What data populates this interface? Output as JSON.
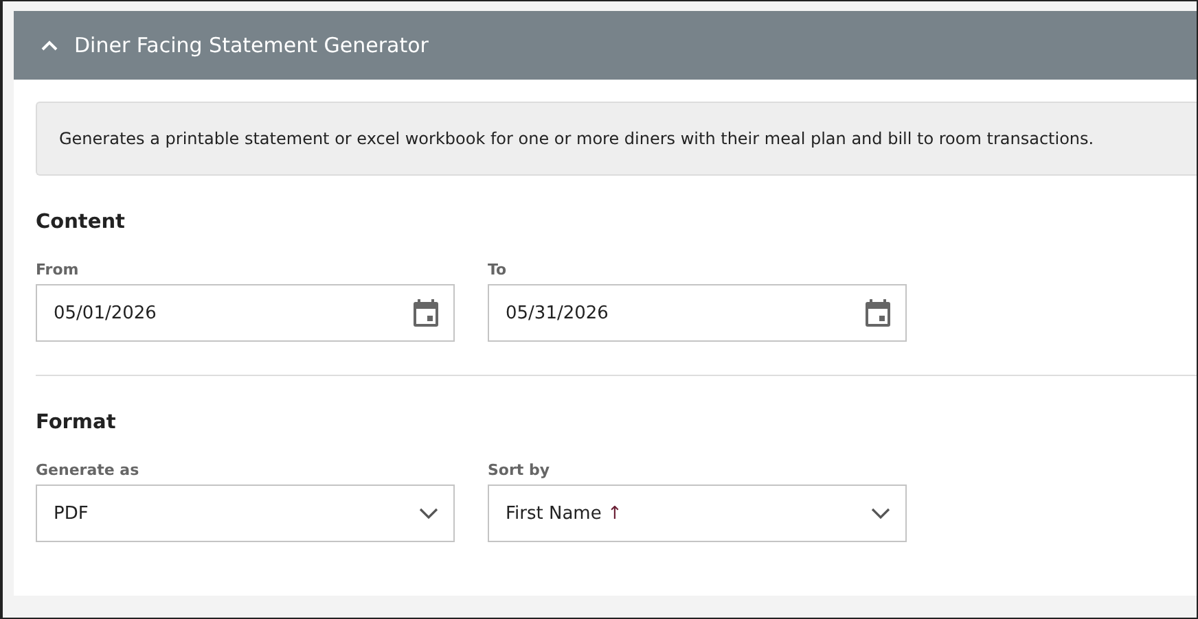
{
  "panel": {
    "title": "Diner Facing Statement Generator",
    "expanded": true
  },
  "info": "Generates a printable statement or excel workbook for one or more diners with their meal plan and bill to room transactions.",
  "sections": [
    {
      "heading": "Content",
      "fields": [
        {
          "kind": "date",
          "label": "From",
          "value": "05/01/2026"
        },
        {
          "kind": "date",
          "label": "To",
          "value": "05/31/2026"
        }
      ]
    },
    {
      "heading": "Format",
      "fields": [
        {
          "kind": "select",
          "label": "Generate as",
          "value": "PDF"
        },
        {
          "kind": "select",
          "label": "Sort by",
          "value": "First Name",
          "direction": "↑"
        }
      ]
    }
  ]
}
